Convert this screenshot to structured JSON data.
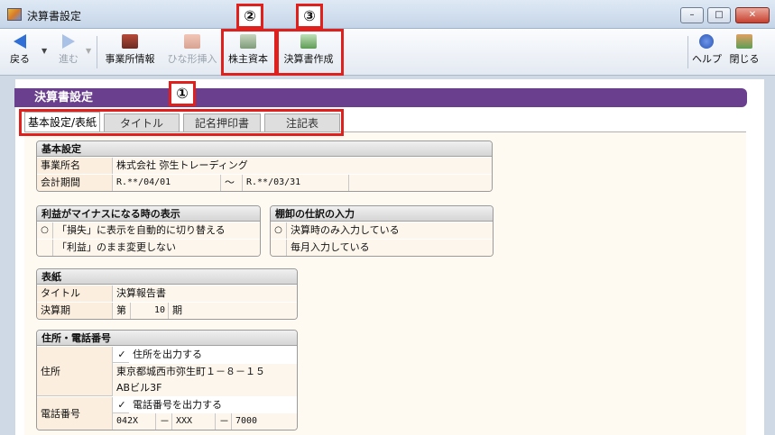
{
  "window": {
    "title": "決算書設定",
    "minimize": "–",
    "maximize": "□",
    "close": "✕"
  },
  "toolbar": {
    "back": "戻る",
    "forward": "進む",
    "office_info": "事業所情報",
    "template_insert": "ひな形挿入",
    "shareholders_equity": "株主資本",
    "create_statements": "決算書作成",
    "help": "ヘルプ",
    "close": "閉じる",
    "dropdown_glyph": "▼"
  },
  "callouts": {
    "c1": "①",
    "c2": "②",
    "c3": "③"
  },
  "section_title": "決算書設定",
  "tabs": [
    "基本設定/表紙",
    "タイトル",
    "記名押印書",
    "注記表"
  ],
  "basic": {
    "header": "基本設定",
    "office_label": "事業所名",
    "office_value": "株式会社 弥生トレーディング",
    "period_label": "会計期間",
    "period_from": "R.**/04/01",
    "period_sep": "～",
    "period_to": "R.**/03/31"
  },
  "loss": {
    "header": "利益がマイナスになる時の表示",
    "option1": "「損失」に表示を自動的に切り替える",
    "option2": "「利益」のまま変更しない",
    "selected_mark": "○"
  },
  "inventory": {
    "header": "棚卸の仕訳の入力",
    "option1": "決算時のみ入力している",
    "option2": "毎月入力している",
    "selected_mark": "○"
  },
  "cover": {
    "header": "表紙",
    "title_label": "タイトル",
    "title_value": "決算報告書",
    "term_label": "決算期",
    "term_prefix": "第",
    "term_value": "10",
    "term_suffix": "期"
  },
  "address": {
    "header": "住所・電話番号",
    "addr_label": "住所",
    "addr_checkbox": "住所を出力する",
    "addr_line1": "東京都城西市弥生町１－８－１５",
    "addr_line2": "ABビル3F",
    "phone_label": "電話番号",
    "phone_checkbox": "電話番号を出力する",
    "phone1": "042X",
    "phone2": "XXX",
    "phone3": "7000",
    "phone_sep": "－",
    "check_mark": "✓"
  },
  "colors": {
    "section_bar": "#6a3f8d",
    "highlight": "#e0201c"
  }
}
